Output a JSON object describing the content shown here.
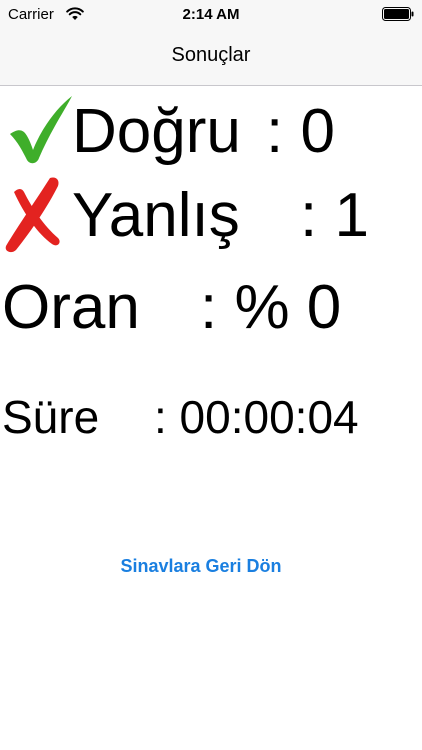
{
  "status_bar": {
    "carrier": "Carrier",
    "time": "2:14 AM",
    "wifi_icon": "wifi-icon",
    "battery_icon": "battery-icon"
  },
  "nav": {
    "title": "Sonuçlar"
  },
  "results": {
    "correct": {
      "icon": "check-mark-icon",
      "label": "Doğru",
      "value": ": 0"
    },
    "wrong": {
      "icon": "cross-mark-icon",
      "label": "Yanlış",
      "value": ": 1"
    },
    "ratio": {
      "label": "Oran",
      "value": ": % 0"
    },
    "time": {
      "label": "Süre",
      "value": ": 00:00:04"
    }
  },
  "actions": {
    "back_label": "Sinavlara Geri Dön"
  },
  "colors": {
    "check": "#3fae2a",
    "cross": "#e32320",
    "link": "#1a7fe0",
    "bar_background": "#f7f7f7"
  }
}
